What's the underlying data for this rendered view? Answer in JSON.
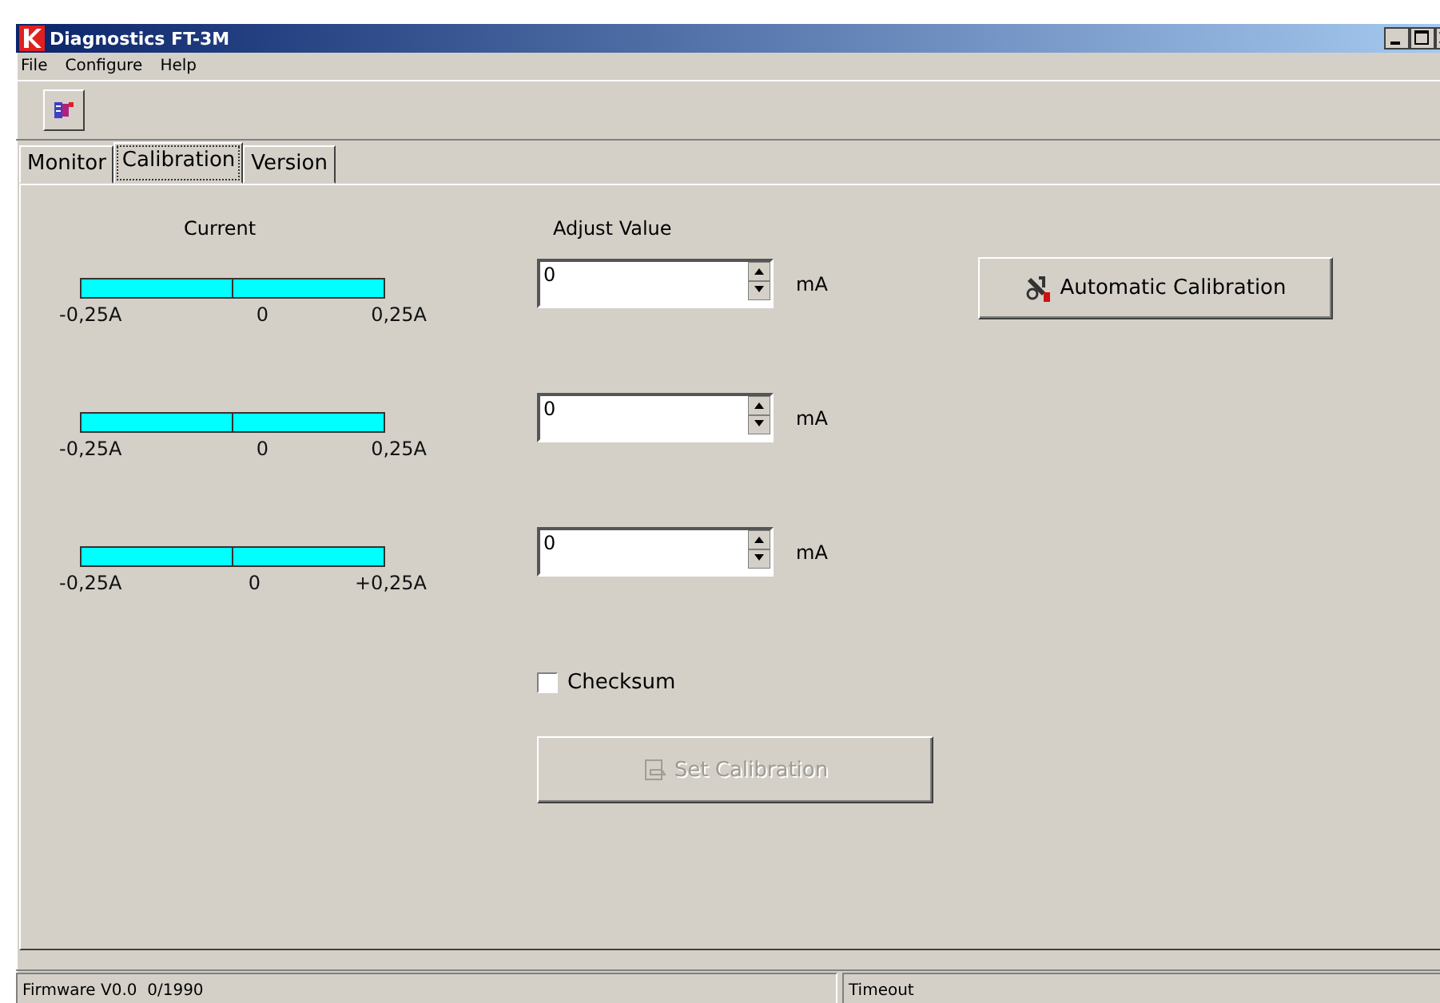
{
  "window": {
    "title": "Diagnostics FT-3M"
  },
  "menu": [
    "File",
    "Configure",
    "Help"
  ],
  "tabs": [
    {
      "label": "Monitor",
      "selected": false
    },
    {
      "label": "Calibration",
      "selected": true
    },
    {
      "label": "Version",
      "selected": false
    }
  ],
  "current": {
    "heading": "Current",
    "meters": [
      {
        "min": "-0,25A",
        "mid": "0",
        "max": "0,25A"
      },
      {
        "min": "-0,25A",
        "mid": "0",
        "max": "0,25A"
      },
      {
        "min": "-0,25A",
        "mid": "0",
        "max": "+0,25A"
      }
    ]
  },
  "adjust": {
    "heading": "Adjust Value",
    "fields": [
      {
        "value": "0",
        "unit": "mA"
      },
      {
        "value": "0",
        "unit": "mA"
      },
      {
        "value": "0",
        "unit": "mA"
      }
    ]
  },
  "automatic_button": {
    "label": "Automatic Calibration"
  },
  "checksum": {
    "label": "Checksum",
    "checked": false
  },
  "set_button": {
    "label": "Set Calibration",
    "disabled": true
  },
  "status_bar": [
    "Firmware V0.0  0/1990",
    "Timeout"
  ]
}
